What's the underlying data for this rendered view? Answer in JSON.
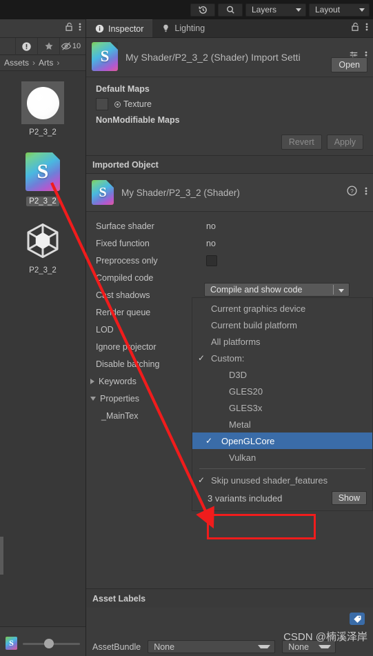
{
  "toolbar": {
    "history_icon": "history-icon",
    "search_icon": "search-icon",
    "layers_label": "Layers",
    "layout_label": "Layout"
  },
  "project_panel": {
    "lock_icon": "lock-icon",
    "menu_icon": "kebab-menu-icon",
    "tools": [
      {
        "name": "warning-filter-icon",
        "glyph": "!"
      },
      {
        "name": "favorite-star-icon",
        "glyph": "★"
      },
      {
        "name": "hidden-eye-icon",
        "glyph": "10"
      }
    ],
    "breadcrumb": [
      "Assets",
      "Arts"
    ],
    "assets": [
      {
        "name": "P2_3_2",
        "icon": "material-sphere-icon",
        "selected": false
      },
      {
        "name": "P2_3_2",
        "icon": "shader-file-icon",
        "selected": true
      },
      {
        "name": "P2_3_2",
        "icon": "prefab-cube-icon",
        "selected": false
      }
    ],
    "footer_icon": "shader-file-icon",
    "zoom_slider_value": 37
  },
  "inspector": {
    "tabs": [
      {
        "label": "Inspector",
        "icon": "info-icon",
        "active": true
      },
      {
        "label": "Lighting",
        "icon": "bulb-icon",
        "active": false
      }
    ],
    "lock_icon": "lock-icon",
    "menu_icon": "kebab-menu-icon",
    "object_title": "My Shader/P2_3_2 (Shader) Import Setti",
    "object_icon": "shader-file-icon",
    "preset_icon": "preset-icon",
    "header_menu_icon": "kebab-menu-icon",
    "open_button": "Open",
    "default_maps": {
      "section_label": "Default Maps",
      "texture_label": "Texture",
      "nonmodifiable_label": "NonModifiable Maps",
      "revert_button": "Revert",
      "apply_button": "Apply"
    },
    "imported_object_header": "Imported Object",
    "imported_object_title": "My Shader/P2_3_2 (Shader)",
    "help_icon": "help-icon",
    "imported_menu_icon": "kebab-menu-icon",
    "properties": [
      {
        "key": "Surface shader",
        "value": "no",
        "type": "text"
      },
      {
        "key": "Fixed function",
        "value": "no",
        "type": "text"
      },
      {
        "key": "Preprocess only",
        "value": "",
        "type": "checkbox"
      },
      {
        "key": "Compiled code",
        "value": "",
        "type": "dropdown"
      },
      {
        "key": "Cast shadows",
        "value": "",
        "type": "text"
      },
      {
        "key": "Render queue",
        "value": "",
        "type": "text"
      },
      {
        "key": "LOD",
        "value": "",
        "type": "text"
      },
      {
        "key": "Ignore projector",
        "value": "",
        "type": "text"
      },
      {
        "key": "Disable batching",
        "value": "",
        "type": "text"
      }
    ],
    "keywords_foldout": "Keywords",
    "properties_foldout": "Properties",
    "property_entry": "_MainTex",
    "compiled_code_dropdown": {
      "selected_label": "Compile and show code",
      "items": [
        {
          "label": "Current graphics device",
          "checked": false,
          "indent": false,
          "selected": false
        },
        {
          "label": "Current build platform",
          "checked": false,
          "indent": false,
          "selected": false
        },
        {
          "label": "All platforms",
          "checked": false,
          "indent": false,
          "selected": false
        },
        {
          "label": "Custom:",
          "checked": true,
          "indent": false,
          "selected": false
        },
        {
          "label": "D3D",
          "checked": false,
          "indent": true,
          "selected": false
        },
        {
          "label": "GLES20",
          "checked": false,
          "indent": true,
          "selected": false
        },
        {
          "label": "GLES3x",
          "checked": false,
          "indent": true,
          "selected": false
        },
        {
          "label": "Metal",
          "checked": false,
          "indent": true,
          "selected": false
        },
        {
          "label": "OpenGLCore",
          "checked": true,
          "indent": true,
          "selected": true
        },
        {
          "label": "Vulkan",
          "checked": false,
          "indent": true,
          "selected": false
        }
      ],
      "skip_unused_label": "Skip unused shader_features",
      "skip_unused_checked": true,
      "variants_text": "3 variants included",
      "show_button": "Show",
      "highlight_color": "#3a6ca8"
    },
    "asset_labels": {
      "header": "Asset Labels",
      "tag_icon": "tag-icon",
      "assetbundle_label": "AssetBundle",
      "bundle_value": "None",
      "variant_value": "None"
    }
  },
  "annotations": {
    "arrow_color": "#f01c1c",
    "box_color": "#f01c1c",
    "watermark": "CSDN @楠溪泽岸"
  }
}
